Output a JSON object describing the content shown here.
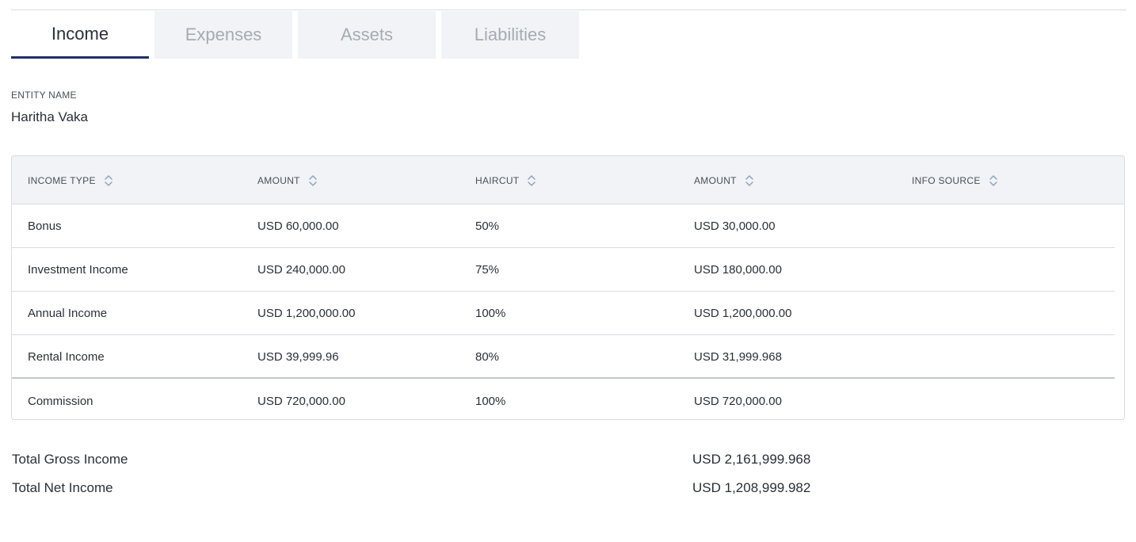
{
  "tabs": [
    {
      "label": "Income",
      "active": true
    },
    {
      "label": "Expenses",
      "active": false
    },
    {
      "label": "Assets",
      "active": false
    },
    {
      "label": "Liabilities",
      "active": false
    }
  ],
  "entity": {
    "label": "ENTITY NAME",
    "value": "Haritha Vaka"
  },
  "table": {
    "headers": [
      "INCOME TYPE",
      "AMOUNT",
      "HAIRCUT",
      "AMOUNT",
      "INFO SOURCE"
    ],
    "rows": [
      [
        "Bonus",
        "USD 60,000.00",
        "50%",
        "USD 30,000.00",
        ""
      ],
      [
        "Investment Income",
        "USD 240,000.00",
        "75%",
        "USD 180,000.00",
        ""
      ],
      [
        "Annual Income",
        "USD 1,200,000.00",
        "100%",
        "USD 1,200,000.00",
        ""
      ],
      [
        "Rental Income",
        "USD 39,999.96",
        "80%",
        "USD 31,999.968",
        ""
      ],
      [
        "Commission",
        "USD 720,000.00",
        "100%",
        "USD 720,000.00",
        ""
      ]
    ]
  },
  "totals": {
    "gross_label": "Total Gross Income",
    "gross_value": "USD 2,161,999.968",
    "net_label": "Total Net Income",
    "net_value": "USD 1,208,999.982"
  },
  "colors": {
    "active_tab_underline": "#24306b",
    "inactive_tab_bg": "#f1f3f6",
    "header_bg": "#f1f3f6",
    "sort_icon": "#8fa3bf"
  },
  "icons": {
    "sort": "sort-updown-icon"
  }
}
